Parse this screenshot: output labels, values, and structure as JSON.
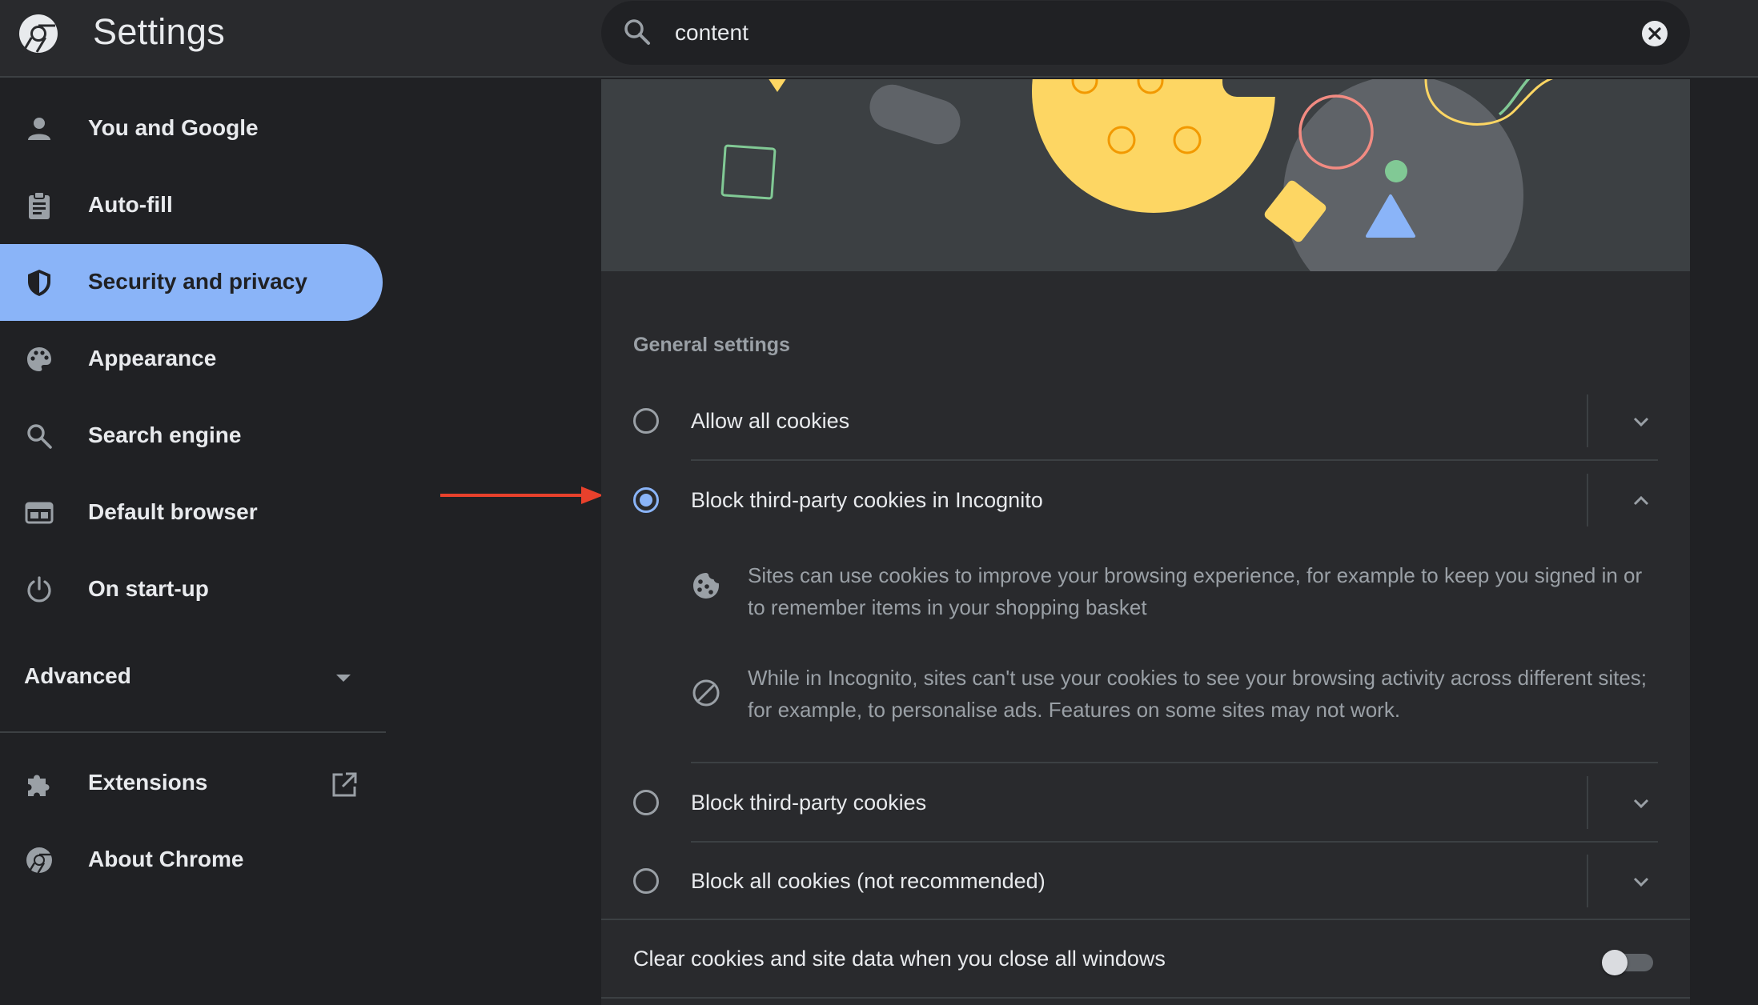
{
  "header": {
    "title": "Settings",
    "search_value": "content"
  },
  "sidebar": {
    "items": [
      {
        "label": "You and Google",
        "icon": "person-icon"
      },
      {
        "label": "Auto-fill",
        "icon": "clipboard-icon"
      },
      {
        "label": "Security and privacy",
        "icon": "shield-icon",
        "active": true
      },
      {
        "label": "Appearance",
        "icon": "palette-icon"
      },
      {
        "label": "Search engine",
        "icon": "search-icon"
      },
      {
        "label": "Default browser",
        "icon": "browser-icon"
      },
      {
        "label": "On start-up",
        "icon": "power-icon"
      }
    ],
    "advanced_label": "Advanced",
    "extensions_label": "Extensions",
    "about_label": "About Chrome"
  },
  "main": {
    "section_title": "General settings",
    "options": [
      {
        "label": "Allow all cookies",
        "selected": false,
        "expanded": false
      },
      {
        "label": "Block third-party cookies in Incognito",
        "selected": true,
        "expanded": true
      },
      {
        "label": "Block third-party cookies",
        "selected": false,
        "expanded": false
      },
      {
        "label": "Block all cookies (not recommended)",
        "selected": false,
        "expanded": false
      }
    ],
    "details": [
      "Sites can use cookies to improve your browsing experience, for example to keep you signed in or to remember items in your shopping basket",
      "While in Incognito, sites can't use your cookies to see your browsing activity across different sites; for example, to personalise ads. Features on some sites may not work."
    ],
    "clear_on_exit_label": "Clear cookies and site data when you close all windows",
    "clear_on_exit_enabled": false
  },
  "colors": {
    "accent": "#8ab4f8",
    "background": "#202124",
    "surface": "#292a2d",
    "annotation_arrow": "#e8412c"
  }
}
